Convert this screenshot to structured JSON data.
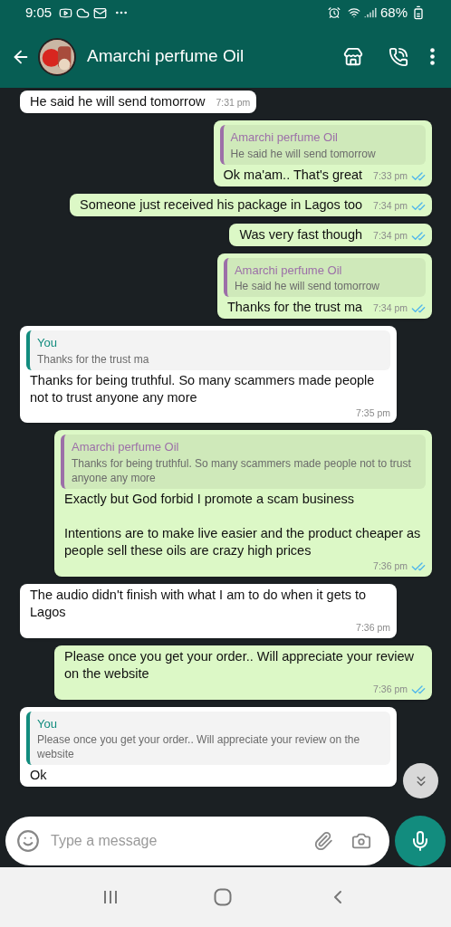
{
  "status_bar": {
    "time": "9:05",
    "battery": "68%"
  },
  "header": {
    "title": "Amarchi perfume Oil"
  },
  "messages": [
    {
      "kind": "incoming",
      "text": "He said he will send tomorrow",
      "time": "7:31 pm"
    },
    {
      "kind": "outgoing",
      "quote": {
        "author": "Amarchi perfume Oil",
        "text": "He said he will send tomorrow",
        "color": "#9c6fa8"
      },
      "text": "Ok ma'am.. That's great",
      "time": "7:33 pm",
      "read": true
    },
    {
      "kind": "outgoing",
      "text": "Someone just received his package in Lagos too",
      "time": "7:34 pm",
      "read": true
    },
    {
      "kind": "outgoing",
      "text": "Was very fast though",
      "time": "7:34 pm",
      "read": true
    },
    {
      "kind": "outgoing",
      "quote": {
        "author": "Amarchi perfume Oil",
        "text": "He said he will send tomorrow",
        "color": "#9c6fa8"
      },
      "text": "Thanks for the trust ma",
      "time": "7:34 pm",
      "read": true
    },
    {
      "kind": "incoming",
      "quote": {
        "author": "You",
        "text": "Thanks for the trust ma",
        "color": "#128c7e"
      },
      "text": "Thanks for being truthful. So many scammers made people not to trust anyone any more",
      "time": "7:35 pm"
    },
    {
      "kind": "outgoing",
      "quote": {
        "author": "Amarchi perfume Oil",
        "text": "Thanks for being truthful. So many scammers made people not to trust anyone any more",
        "color": "#9c6fa8"
      },
      "text": "Exactly but God forbid I promote a scam business\n\nIntentions are to make live easier and the product cheaper as people sell these oils are crazy high prices",
      "time": "7:36 pm",
      "read": true
    },
    {
      "kind": "incoming",
      "text": "The audio didn't finish with what I am to do when it gets to Lagos",
      "time": "7:36 pm"
    },
    {
      "kind": "outgoing",
      "text": "Please once you get your order.. Will appreciate your review on the website",
      "time": "7:36 pm",
      "read": true
    },
    {
      "kind": "incoming",
      "quote": {
        "author": "You",
        "text": "Please once you get your order.. Will appreciate your review on the website",
        "color": "#128c7e"
      },
      "text": "Ok"
    }
  ],
  "composer": {
    "placeholder": "Type a message"
  }
}
